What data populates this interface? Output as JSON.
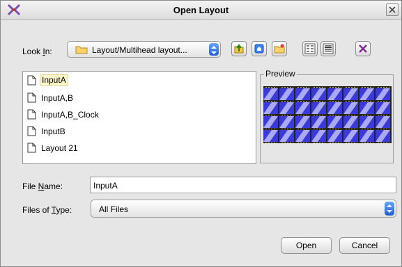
{
  "window": {
    "title": "Open Layout"
  },
  "look_in": {
    "label_prefix": "Look ",
    "label_key": "I",
    "label_suffix": "n:",
    "value": "Layout/Multihead layout..."
  },
  "toolbar": {
    "icons": [
      "up-folder-icon",
      "home-icon",
      "new-folder-icon",
      "list-view-icon",
      "details-view-icon",
      "delete-icon"
    ]
  },
  "files": [
    {
      "name": "InputA",
      "selected": true
    },
    {
      "name": "InputA,B",
      "selected": false
    },
    {
      "name": "InputA,B_Clock",
      "selected": false
    },
    {
      "name": "InputB",
      "selected": false
    },
    {
      "name": "Layout 21",
      "selected": false
    }
  ],
  "preview": {
    "title": "Preview"
  },
  "file_name": {
    "label_prefix": "File ",
    "label_key": "N",
    "label_suffix": "ame:",
    "value": "InputA"
  },
  "file_type": {
    "label_prefix": "Files of ",
    "label_key": "T",
    "label_suffix": "ype:",
    "value": "All Files"
  },
  "buttons": {
    "open": "Open",
    "cancel": "Cancel"
  },
  "colors": {
    "accent": "#2f6ee0",
    "preview_blue": "#3a3ad8"
  }
}
